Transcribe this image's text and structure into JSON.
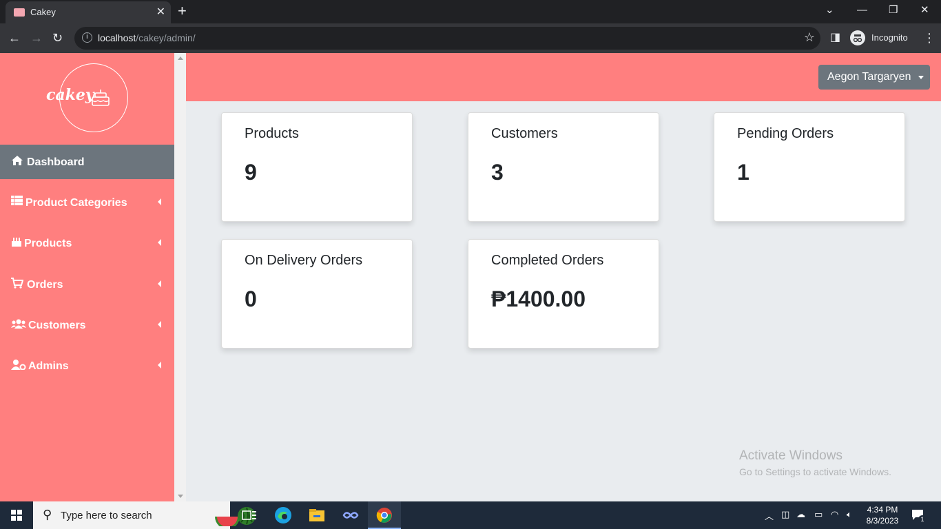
{
  "browser": {
    "tab_title": "Cakey",
    "url_host": "localhost",
    "url_path": "/cakey/admin/",
    "profile_label": "Incognito"
  },
  "sidebar": {
    "logo_text": "cakey",
    "items": [
      {
        "label": "Dashboard",
        "icon": "home-icon",
        "active": true
      },
      {
        "label": "Product Categories",
        "icon": "table-list-icon"
      },
      {
        "label": "Products",
        "icon": "cake-icon"
      },
      {
        "label": "Orders",
        "icon": "cart-icon"
      },
      {
        "label": "Customers",
        "icon": "users-icon"
      },
      {
        "label": "Admins",
        "icon": "user-gear-icon"
      }
    ]
  },
  "header": {
    "user_name": "Aegon Targaryen"
  },
  "cards": [
    {
      "title": "Products",
      "value": "9"
    },
    {
      "title": "Customers",
      "value": "3"
    },
    {
      "title": "Pending Orders",
      "value": "1"
    },
    {
      "title": "On Delivery Orders",
      "value": "0"
    },
    {
      "title": "Completed Orders",
      "value": "₱1400.00"
    }
  ],
  "watermark": {
    "line1": "Activate Windows",
    "line2": "Go to Settings to activate Windows."
  },
  "taskbar": {
    "search_placeholder": "Type here to search",
    "time": "4:34 PM",
    "date": "8/3/2023",
    "notification_count": "1"
  },
  "colors": {
    "accent": "#ff7f7f",
    "active_nav": "#6c757d",
    "content_bg": "#e9ecef"
  }
}
